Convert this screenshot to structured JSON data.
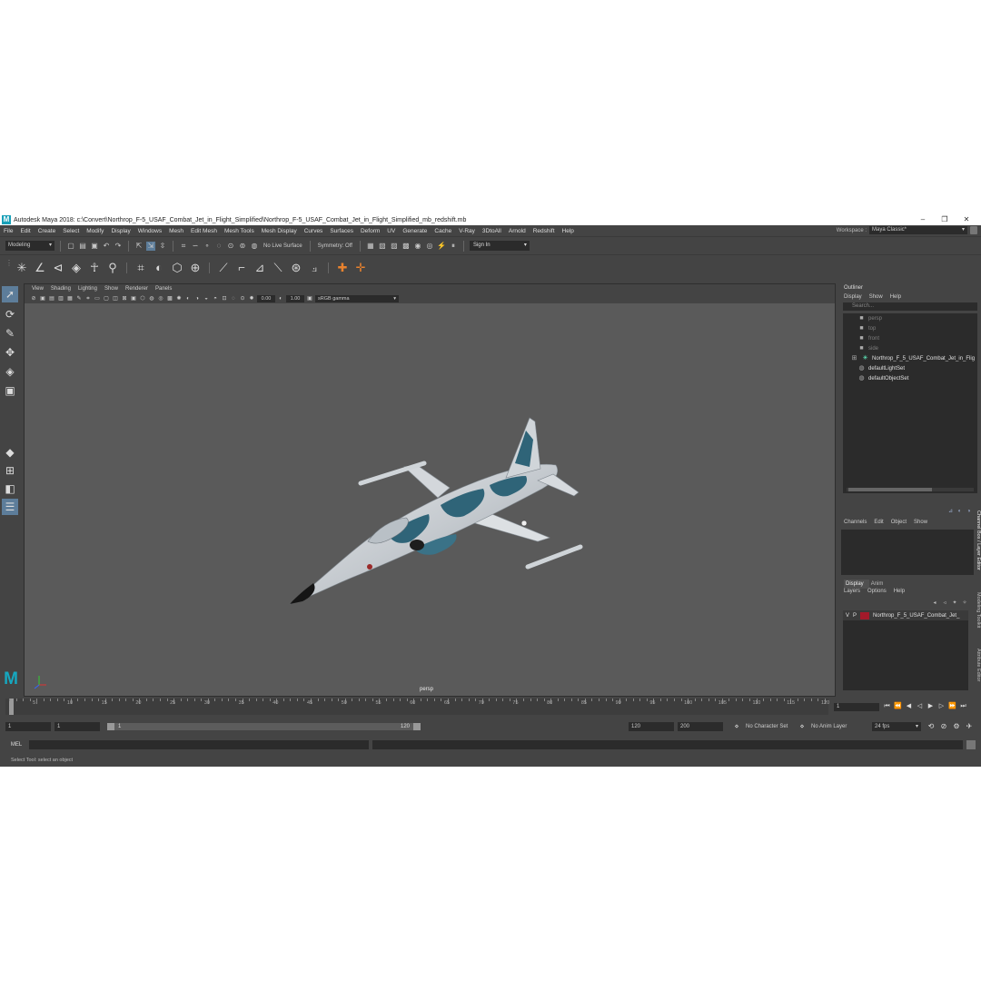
{
  "window": {
    "logo": "M",
    "title": "Autodesk Maya 2018: c:\\Convert\\Northrop_F-5_USAF_Combat_Jet_in_Flight_Simplified\\Northrop_F-5_USAF_Combat_Jet_in_Flight_Simplified_mb_redshift.mb",
    "minimize": "–",
    "maximize": "❐",
    "close": "✕"
  },
  "menu": [
    "File",
    "Edit",
    "Create",
    "Select",
    "Modify",
    "Display",
    "Windows",
    "Mesh",
    "Edit Mesh",
    "Mesh Tools",
    "Mesh Display",
    "Curves",
    "Surfaces",
    "Deform",
    "UV",
    "Generate",
    "Cache",
    "V-Ray",
    "3DtoAll",
    "Arnold",
    "Redshift",
    "Help"
  ],
  "workspace": {
    "label": "Workspace :",
    "value": "Maya Classic*"
  },
  "statusline": {
    "mode": "Modeling",
    "live_surface": "No Live Surface",
    "symmetry": "Symmetry: Off",
    "signin": "Sign In"
  },
  "viewport": {
    "menu": [
      "View",
      "Shading",
      "Lighting",
      "Show",
      "Renderer",
      "Panels"
    ],
    "exposure": "0.00",
    "gamma_value": "1.00",
    "color_space": "sRGB gamma",
    "camera": "persp"
  },
  "outliner": {
    "title": "Outliner",
    "menu": [
      "Display",
      "Show",
      "Help"
    ],
    "search_placeholder": "Search...",
    "items": [
      {
        "label": "persp",
        "icon": "camera-icon",
        "state": "dim"
      },
      {
        "label": "top",
        "icon": "camera-icon",
        "state": "dim"
      },
      {
        "label": "front",
        "icon": "camera-icon",
        "state": "dim"
      },
      {
        "label": "side",
        "icon": "camera-icon",
        "state": "dim"
      },
      {
        "label": "Northrop_F_5_USAF_Combat_Jet_in_Flig",
        "icon": "transform-icon",
        "state": "bright"
      },
      {
        "label": "defaultLightSet",
        "icon": "set-icon",
        "state": "bright"
      },
      {
        "label": "defaultObjectSet",
        "icon": "set-icon",
        "state": "bright"
      }
    ]
  },
  "channelbox": {
    "menu": [
      "Channels",
      "Edit",
      "Object",
      "Show"
    ]
  },
  "layers": {
    "tabs": [
      "Display",
      "Anim"
    ],
    "menu": [
      "Layers",
      "Options",
      "Help"
    ],
    "row": {
      "v": "V",
      "p": "P",
      "name": "Northrop_F_5_USAF_Combat_Jet_",
      "color": "#a21a2a"
    }
  },
  "sidetabs": [
    "Channel Box / Layer Editor",
    "Modeling Toolkit",
    "Attribute Editor"
  ],
  "timeline": {
    "start": 1,
    "end": 120,
    "major_ticks": [
      5,
      10,
      15,
      20,
      25,
      30,
      35,
      40,
      45,
      50,
      55,
      60,
      65,
      70,
      75,
      80,
      85,
      90,
      95,
      100,
      105,
      110,
      115,
      120
    ],
    "current_frame": "1"
  },
  "range": {
    "start_field": "1",
    "playback_start": "1",
    "slider_start": "1",
    "slider_end": "120",
    "playback_end": "120",
    "end_field": "200",
    "character_set": "No Character Set",
    "anim_layer": "No Anim Layer",
    "fps": "24 fps"
  },
  "cmdline": {
    "lang": "MEL"
  },
  "help": "Select Tool: select an object"
}
